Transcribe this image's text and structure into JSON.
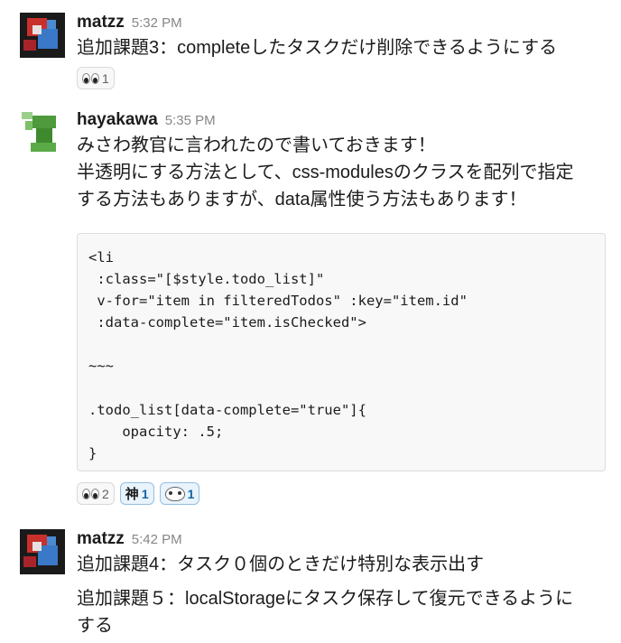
{
  "messages": [
    {
      "author": "matzz",
      "time": "5:32 PM",
      "lines": [
        "追加課題3：completeしたタスクだけ削除できるようにする"
      ],
      "reactions": [
        {
          "emoji": "eyes",
          "count": "1"
        }
      ]
    },
    {
      "author": "hayakawa",
      "time": "5:35 PM",
      "lines": [
        "みさわ教官に言われたので書いておきます！",
        "半透明にする方法として、css-modulesのクラスを配列で指定",
        "する方法もありますが、data属性使う方法もあります！"
      ],
      "code": "<li\n :class=\"[$style.todo_list]\"\n v-for=\"item in filteredTodos\" :key=\"item.id\"\n :data-complete=\"item.isChecked\">\n\n~~~\n\n.todo_list[data-complete=\"true\"]{\n    opacity: .5;\n}",
      "reactions": [
        {
          "emoji": "eyes",
          "count": "2"
        },
        {
          "emoji": "kami",
          "label": "神",
          "count": "1"
        },
        {
          "emoji": "face",
          "count": "1"
        }
      ]
    },
    {
      "author": "matzz",
      "time": "5:42 PM",
      "lines": [
        "追加課題4：タスク０個のときだけ特別な表示出す"
      ],
      "lines2": [
        "追加課題５：localStorageにタスク保存して復元できるように",
        "する"
      ]
    }
  ],
  "colors": {
    "author": "#1d1c1d",
    "timestamp": "#868686",
    "reaction_active_border": "#94bee2",
    "reaction_active_bg": "#e8f3fc"
  }
}
